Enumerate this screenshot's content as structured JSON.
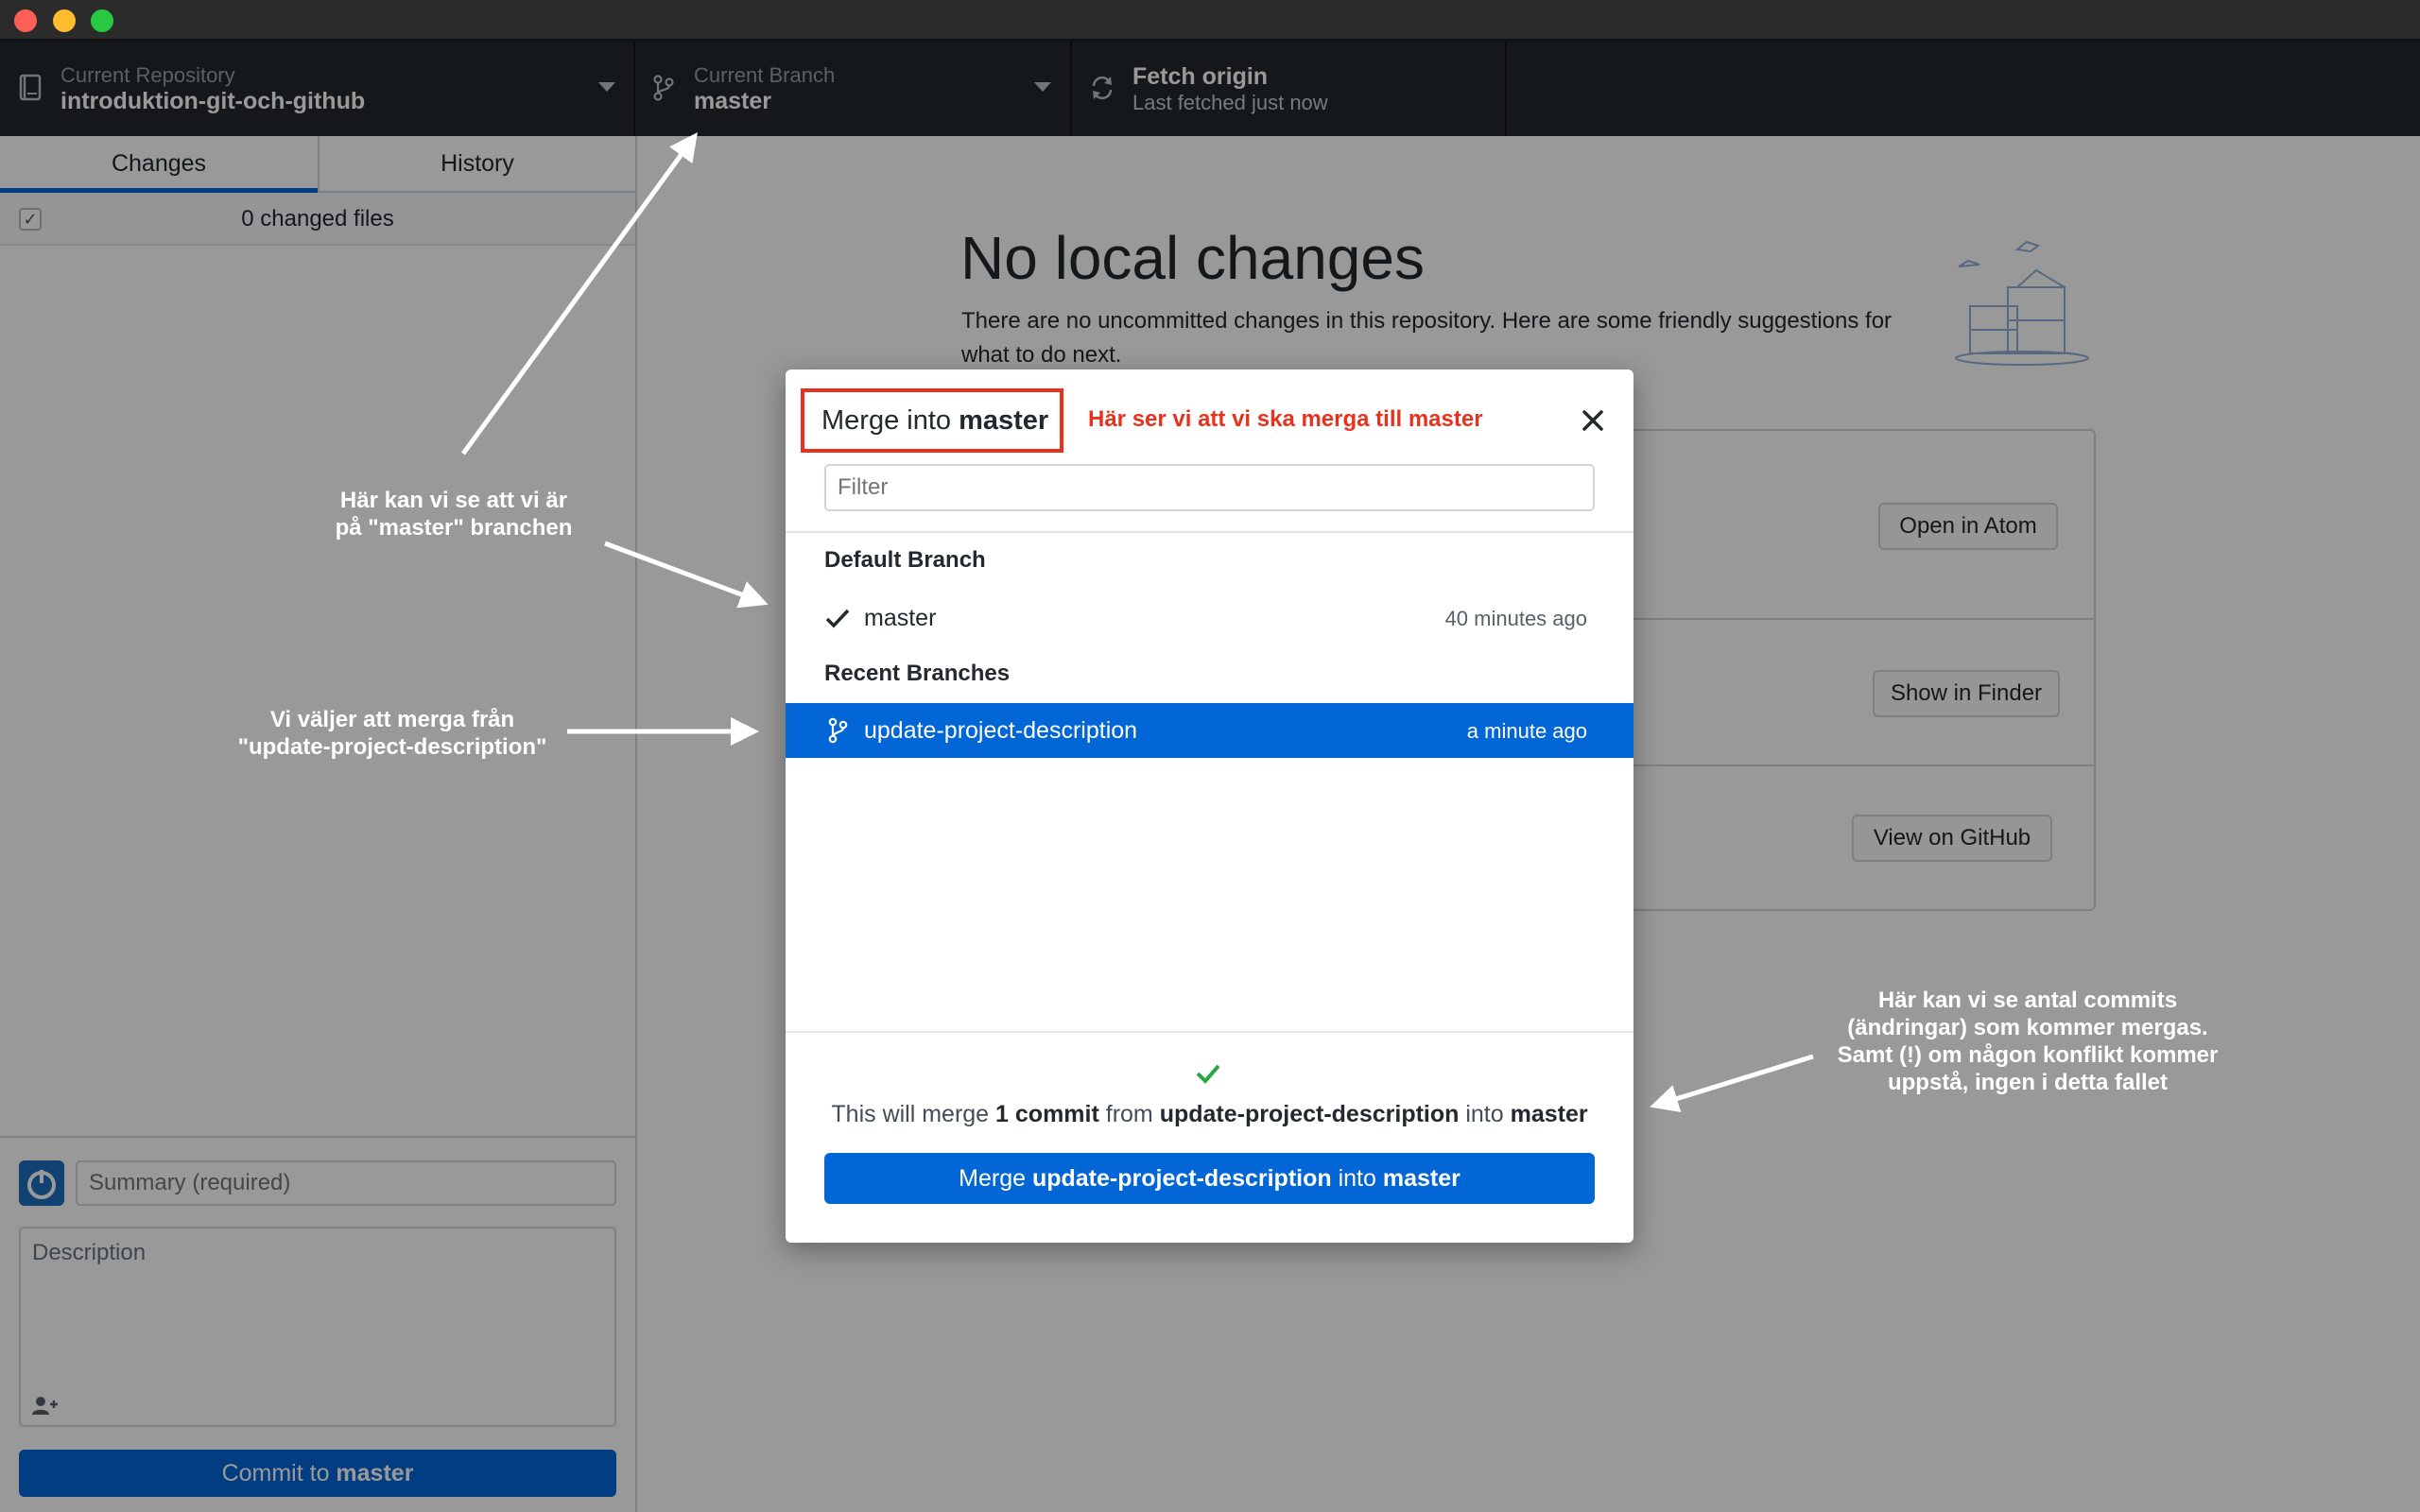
{
  "window": {
    "controls": [
      "close",
      "minimize",
      "maximize"
    ]
  },
  "toolbar": {
    "repository": {
      "label": "Current Repository",
      "value": "introduktion-git-och-github",
      "icon": "repo-icon"
    },
    "branch": {
      "label": "Current Branch",
      "value": "master",
      "icon": "git-branch-icon"
    },
    "fetch": {
      "label": "Fetch origin",
      "status": "Last fetched just now",
      "icon": "sync-icon"
    }
  },
  "sidebar": {
    "tabs": [
      {
        "label": "Changes",
        "active": true
      },
      {
        "label": "History",
        "active": false
      }
    ],
    "changed_files": "0 changed files",
    "commit": {
      "summary_placeholder": "Summary (required)",
      "description_placeholder": "Description",
      "button_prefix": "Commit to ",
      "button_branch": "master"
    }
  },
  "main": {
    "title": "No local changes",
    "description": "There are no uncommitted changes in this repository. Here are some friendly suggestions for what to do next.",
    "actions": [
      {
        "label": "Open in Atom"
      },
      {
        "label": "Show in Finder"
      },
      {
        "label": "View on GitHub"
      }
    ]
  },
  "dialog": {
    "title_prefix": "Merge into ",
    "title_branch": "master",
    "filter_placeholder": "Filter",
    "default_group": "Default Branch",
    "default_branch": {
      "name": "master",
      "time": "40 minutes ago",
      "icon": "check-icon"
    },
    "recent_group": "Recent Branches",
    "recent_branches": [
      {
        "name": "update-project-description",
        "time": "a minute ago",
        "icon": "git-branch-icon",
        "selected": true
      }
    ],
    "summary": {
      "prefix": "This will merge ",
      "count": "1 commit",
      "from_word": " from ",
      "source": "update-project-description",
      "into_word": " into ",
      "target": "master"
    },
    "merge_button": {
      "prefix": "Merge ",
      "source": "update-project-description",
      "into_word": " into ",
      "target": "master"
    }
  },
  "annotations": {
    "red_note": "Här ser vi att vi ska merga till master",
    "note_branch": [
      "Här kan vi se att vi är",
      "på \"master\" branchen"
    ],
    "note_merge_from": [
      "Vi väljer att merga från",
      "\"update-project-description\""
    ],
    "note_commits": [
      "Här kan vi se antal commits",
      "(ändringar) som kommer mergas.",
      "Samt (!) om någon konflikt kommer",
      "uppstå, ingen i detta fallet"
    ]
  },
  "colors": {
    "accent": "#0366d6",
    "toolbar_bg": "#24292e",
    "annotation_red": "#e8321e",
    "success_green": "#28a745",
    "overlay": "rgba(0,0,0,0.4)"
  }
}
